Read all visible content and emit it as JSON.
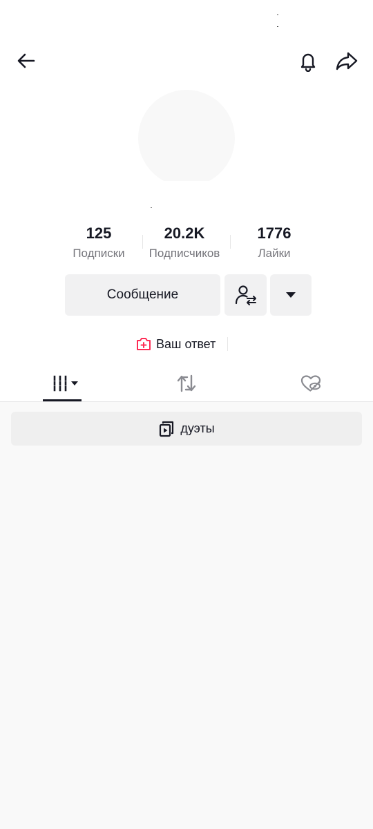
{
  "header": {
    "back_icon": "arrow-left-icon",
    "bell_icon": "bell-icon",
    "share_icon": "share-arrow-icon"
  },
  "stats": [
    {
      "value": "125",
      "label": "Подписки"
    },
    {
      "value": "20.2K",
      "label": "Подписчиков"
    },
    {
      "value": "1776",
      "label": "Лайки"
    }
  ],
  "actions": {
    "message_label": "Сообщение",
    "follow_icon": "user-swap-icon",
    "more_icon": "caret-down-icon"
  },
  "reply": {
    "label": "Ваш ответ",
    "icon": "camera-plus-icon",
    "icon_color": "#fe2c55"
  },
  "tabs": [
    {
      "name": "videos",
      "icon": "grid-icon",
      "active": true
    },
    {
      "name": "reposts",
      "icon": "repost-icon",
      "active": false
    },
    {
      "name": "liked",
      "icon": "heart-hidden-icon",
      "active": false
    }
  ],
  "content": {
    "duets_label": "дуэты",
    "duets_icon": "duet-icon"
  }
}
